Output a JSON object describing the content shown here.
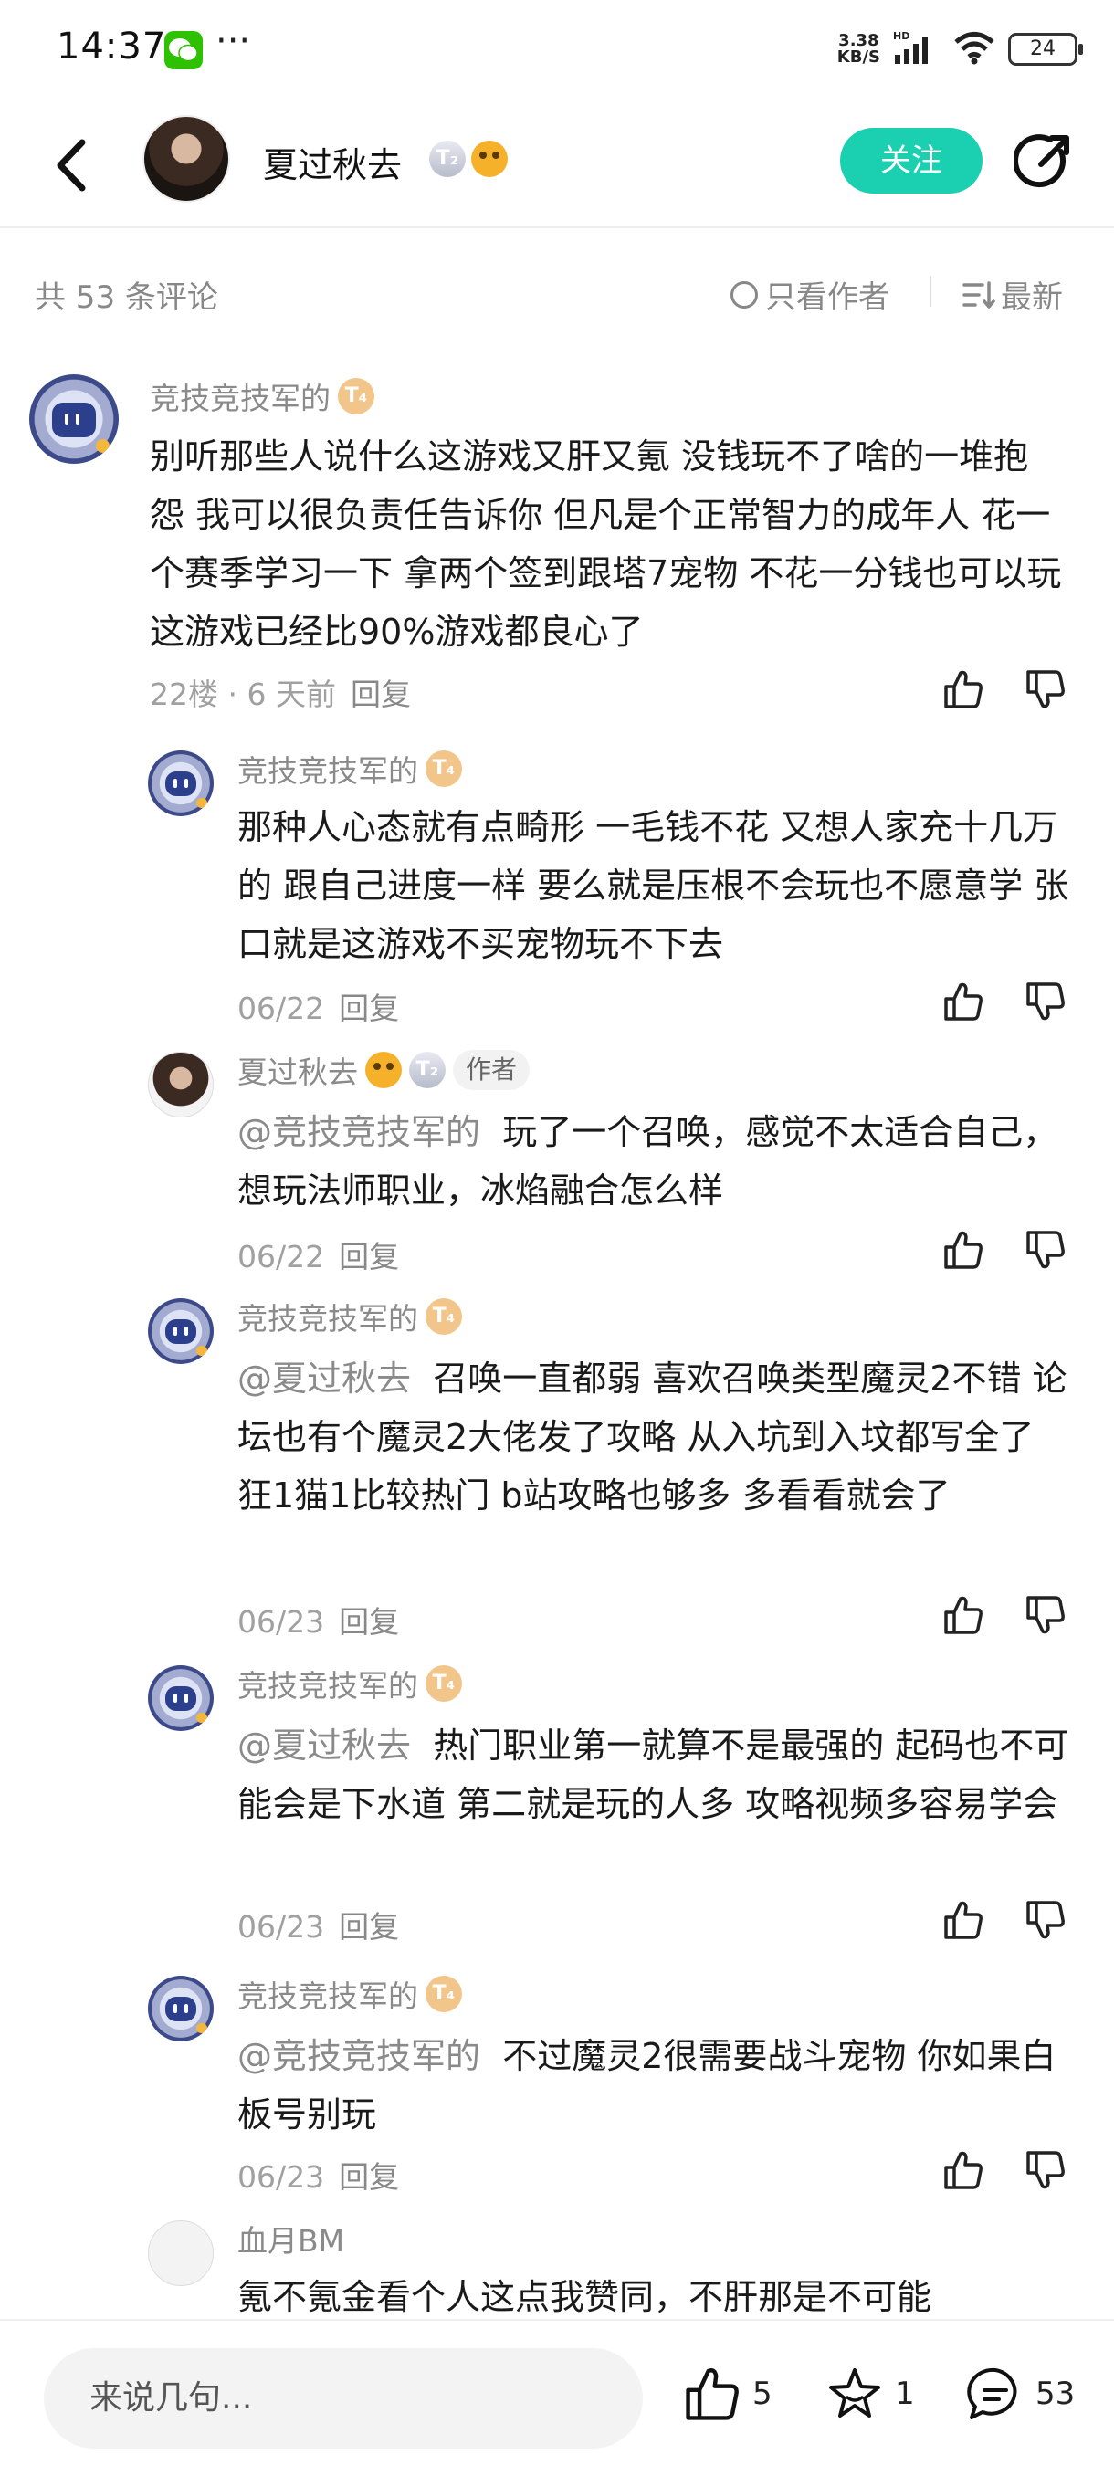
{
  "status_bar": {
    "time": "14:37",
    "dots": "···",
    "net_speed_value": "3.38",
    "net_speed_unit": "KB/S",
    "network": "HD",
    "battery": "24"
  },
  "header": {
    "username": "夏过秋去",
    "level_badge": "T₂",
    "follow_label": "关注"
  },
  "summary": {
    "count_label": "共 53 条评论",
    "only_author_label": "只看作者",
    "sort_label": "最新"
  },
  "comments": [
    {
      "user": "竞技竞技军的",
      "badge": "T₄",
      "text": "别听那些人说什么这游戏又肝又氪 没钱玩不了啥的一堆抱怨 我可以很负责任告诉你 但凡是个正常智力的成年人 花一个赛季学习一下 拿两个签到跟塔7宠物 不花一分钱也可以玩 这游戏已经比90%游戏都良心了",
      "meta": "22楼 · 6 天前",
      "reply": "回复"
    },
    {
      "user": "竞技竞技军的",
      "badge": "T₄",
      "text": "那种人心态就有点畸形 一毛钱不花 又想人家充十几万的 跟自己进度一样 要么就是压根不会玩也不愿意学 张口就是这游戏不买宠物玩不下去",
      "meta": "06/22",
      "reply": "回复"
    },
    {
      "user": "夏过秋去",
      "badge": "T₂",
      "author_tag": "作者",
      "mention": "@竞技竞技军的",
      "text": "玩了一个召唤，感觉不太适合自己，想玩法师职业，冰焰融合怎么样",
      "meta": "06/22",
      "reply": "回复"
    },
    {
      "user": "竞技竞技军的",
      "badge": "T₄",
      "mention": "@夏过秋去",
      "text": "召唤一直都弱 喜欢召唤类型魔灵2不错 论坛也有个魔灵2大佬发了攻略 从入坑到入坟都写全了 狂1猫1比较热门 b站攻略也够多 多看看就会了",
      "meta": "06/23",
      "reply": "回复"
    },
    {
      "user": "竞技竞技军的",
      "badge": "T₄",
      "mention": "@夏过秋去",
      "text": "热门职业第一就算不是最强的 起码也不可能会是下水道 第二就是玩的人多 攻略视频多容易学会",
      "meta": "06/23",
      "reply": "回复"
    },
    {
      "user": "竞技竞技军的",
      "badge": "T₄",
      "mention": "@竞技竞技军的",
      "text": "不过魔灵2很需要战斗宠物 你如果白板号别玩",
      "meta": "06/23",
      "reply": "回复"
    },
    {
      "user": "血月BM",
      "text": "氪不氪金看个人这点我赞同，不肝那是不可能"
    }
  ],
  "bottom_bar": {
    "input_placeholder": "来说几句...",
    "like_count": "5",
    "favorite_count": "1",
    "comment_count": "53"
  },
  "colors": {
    "accent": "#1ad0b0",
    "text_secondary": "#8a8a8a"
  }
}
